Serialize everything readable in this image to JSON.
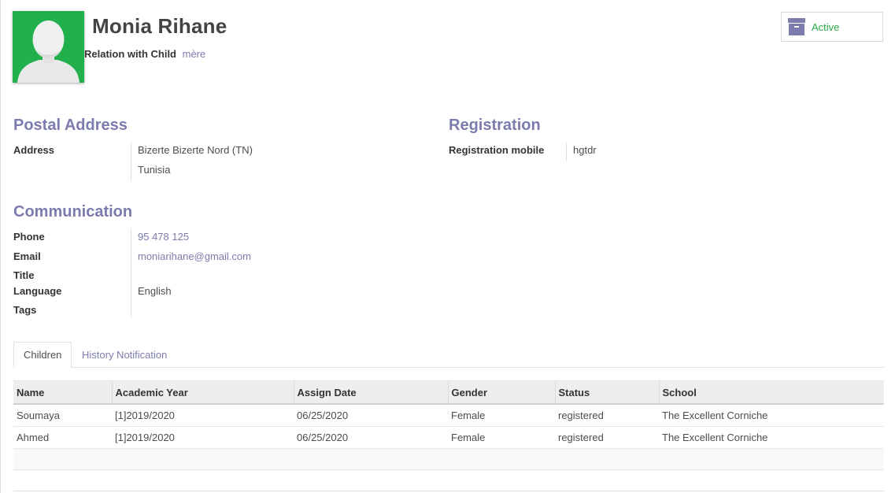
{
  "header": {
    "name": "Monia Rihane",
    "relation_label": "Relation with Child",
    "relation_value": "mère",
    "status_button": "Active"
  },
  "postal": {
    "title": "Postal Address",
    "address_label": "Address",
    "address_line1": "Bizerte  Bizerte Nord (TN)",
    "address_line2": "Tunisia"
  },
  "registration": {
    "title": "Registration",
    "mobile_label": "Registration mobile",
    "mobile_value": "hgtdr"
  },
  "communication": {
    "title": "Communication",
    "phone_label": "Phone",
    "phone_value": "95 478 125",
    "email_label": "Email",
    "email_value": "moniarihane@gmail.com",
    "title_label": "Title",
    "language_label": "Language",
    "language_value": "English",
    "tags_label": "Tags"
  },
  "tabs": [
    "Children",
    "History Notification"
  ],
  "children_table": {
    "columns": [
      "Name",
      "Academic Year",
      "Assign Date",
      "Gender",
      "Status",
      "School"
    ],
    "rows": [
      [
        "Soumaya",
        "[1]2019/2020",
        "06/25/2020",
        "Female",
        "registered",
        "The Excellent Corniche"
      ],
      [
        "Ahmed",
        "[1]2019/2020",
        "06/25/2020",
        "Female",
        "registered",
        "The Excellent Corniche"
      ]
    ]
  },
  "colors": {
    "accent": "#7c7bad",
    "active_green": "#28a745",
    "avatar_bg": "#21b04b"
  },
  "icons": {
    "avatar": "user-silhouette",
    "archive": "archive-box-icon"
  }
}
